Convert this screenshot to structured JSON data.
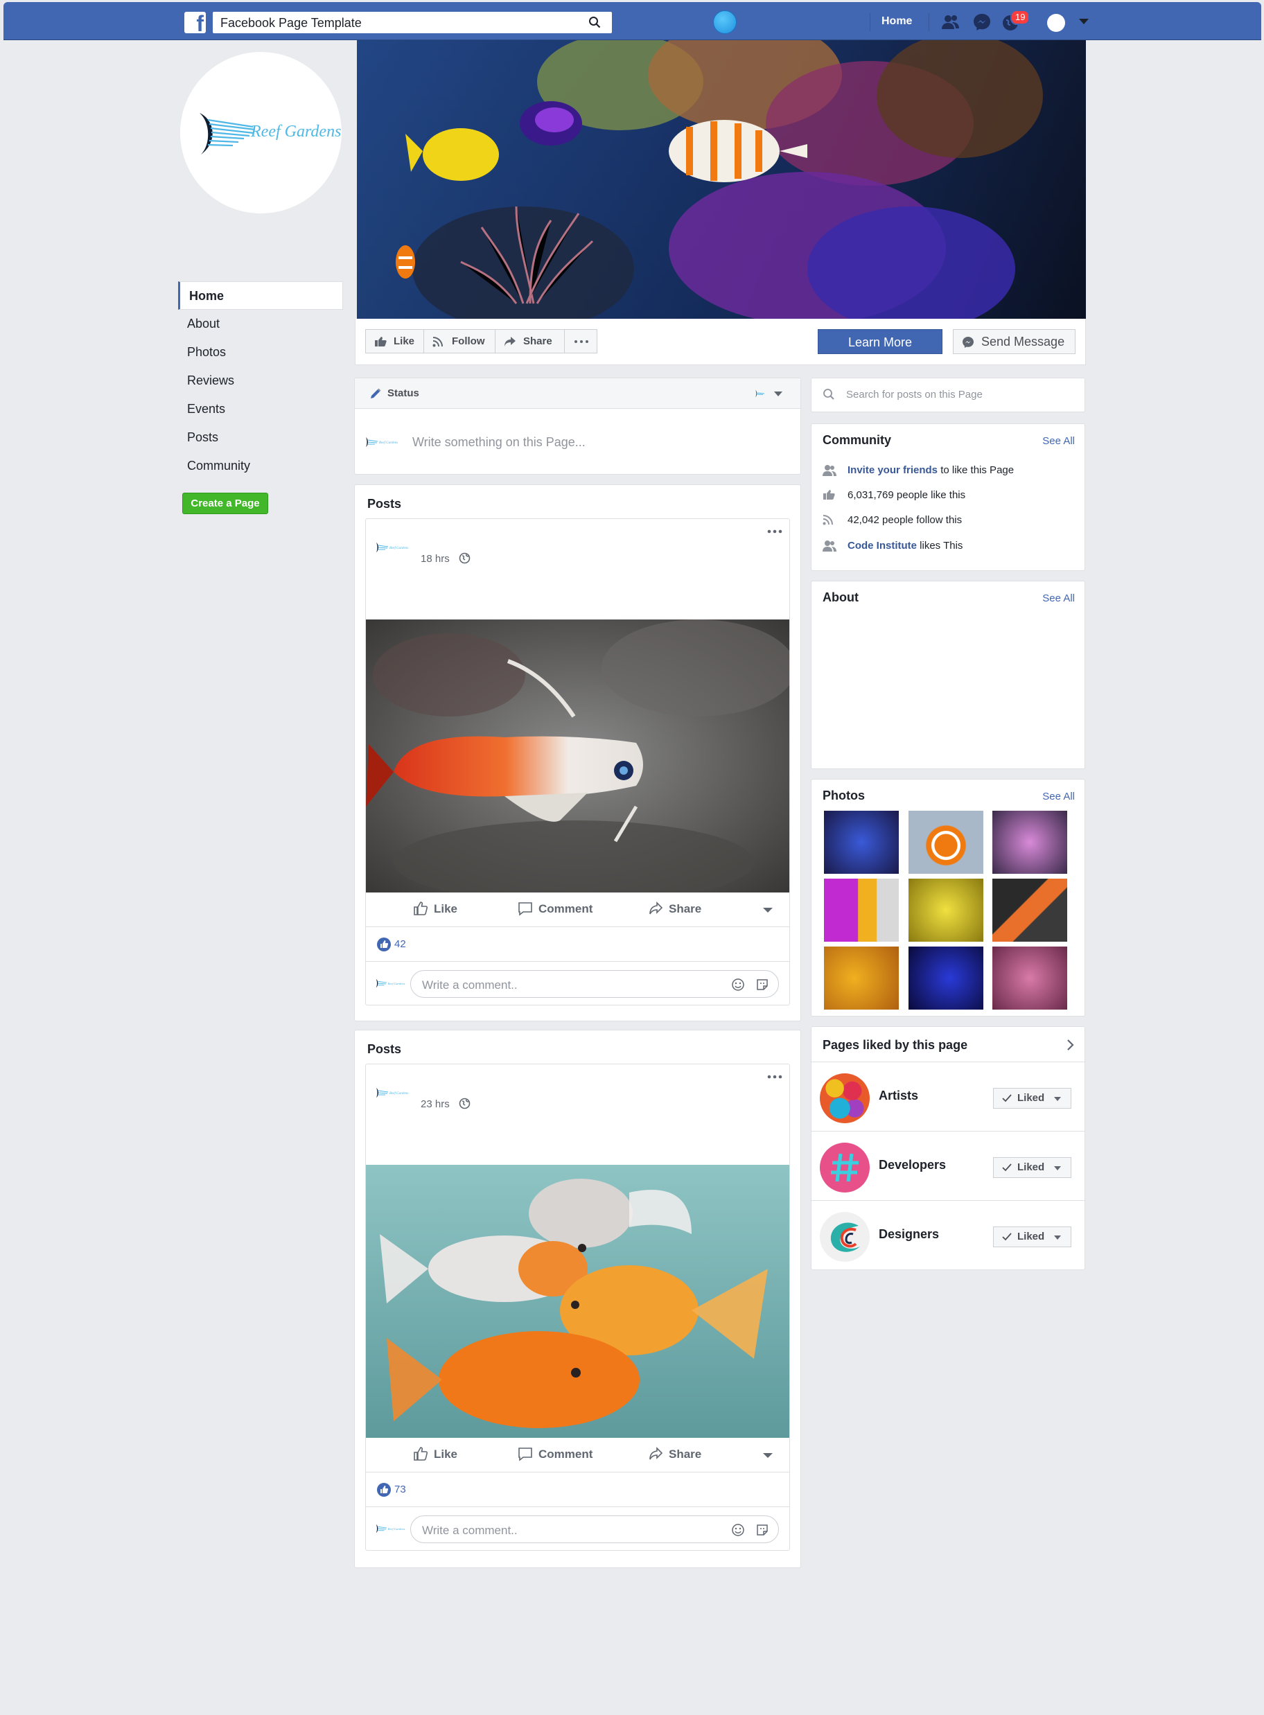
{
  "topbar": {
    "search_value": "Facebook Page Template",
    "home_label": "Home",
    "notification_count": "19"
  },
  "left_nav": {
    "items": [
      "Home",
      "About",
      "Photos",
      "Reviews",
      "Events",
      "Posts",
      "Community"
    ],
    "create_page_label": "Create a Page"
  },
  "profile": {
    "logo_text": "Reef Gardens"
  },
  "actions": {
    "like": "Like",
    "follow": "Follow",
    "share": "Share",
    "learn_more": "Learn More",
    "send_message": "Send Message"
  },
  "status": {
    "label": "Status",
    "placeholder": "Write something on this Page..."
  },
  "posts": [
    {
      "title": "Posts",
      "time": "18 hrs",
      "likes": "42",
      "like_label": "Like",
      "comment_label": "Comment",
      "share_label": "Share",
      "comment_placeholder": "Write a comment.."
    },
    {
      "title": "Posts",
      "time": "23 hrs",
      "likes": "73",
      "like_label": "Like",
      "comment_label": "Comment",
      "share_label": "Share",
      "comment_placeholder": "Write a comment.."
    }
  ],
  "right": {
    "search_placeholder": "Search for posts on this Page",
    "community": {
      "title": "Community",
      "see_all": "See All",
      "invite_link": "Invite your friends",
      "invite_rest": " to like this Page",
      "likes_line": "6,031,769 people like this",
      "follows_line": "42,042 people follow this",
      "liker_name": "Code Institute",
      "liker_rest": " likes This"
    },
    "about": {
      "title": "About",
      "see_all": "See All"
    },
    "photos": {
      "title": "Photos",
      "see_all": "See All"
    },
    "pages_liked": {
      "title": "Pages liked by this page",
      "liked_label": "Liked",
      "pages": [
        "Artists",
        "Developers",
        "Designers"
      ]
    }
  },
  "colors": {
    "brand_blue": "#4267b2",
    "link_blue": "#385898",
    "green": "#42b72a",
    "page_bg": "#e9ebee"
  }
}
